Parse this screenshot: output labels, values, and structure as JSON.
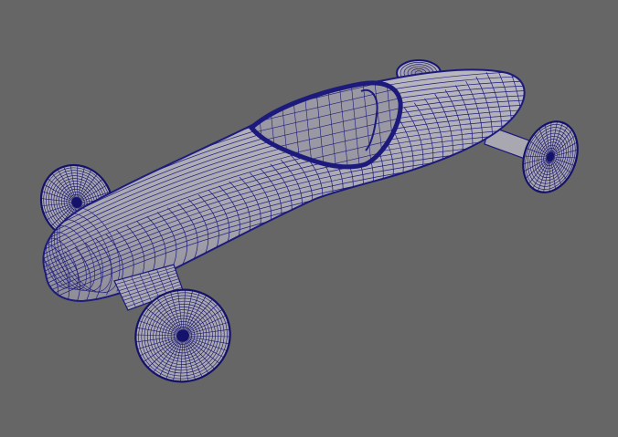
{
  "viewport": {
    "background_color": "#666666",
    "display_mode": "wireframe-on-shaded",
    "object": "soapbox-racer-car",
    "colors": {
      "surface": "#aaa8b0",
      "surface_shadow": "#8d8b96",
      "wire": "#1c1a7c",
      "wire_dense": "#14126a"
    }
  }
}
